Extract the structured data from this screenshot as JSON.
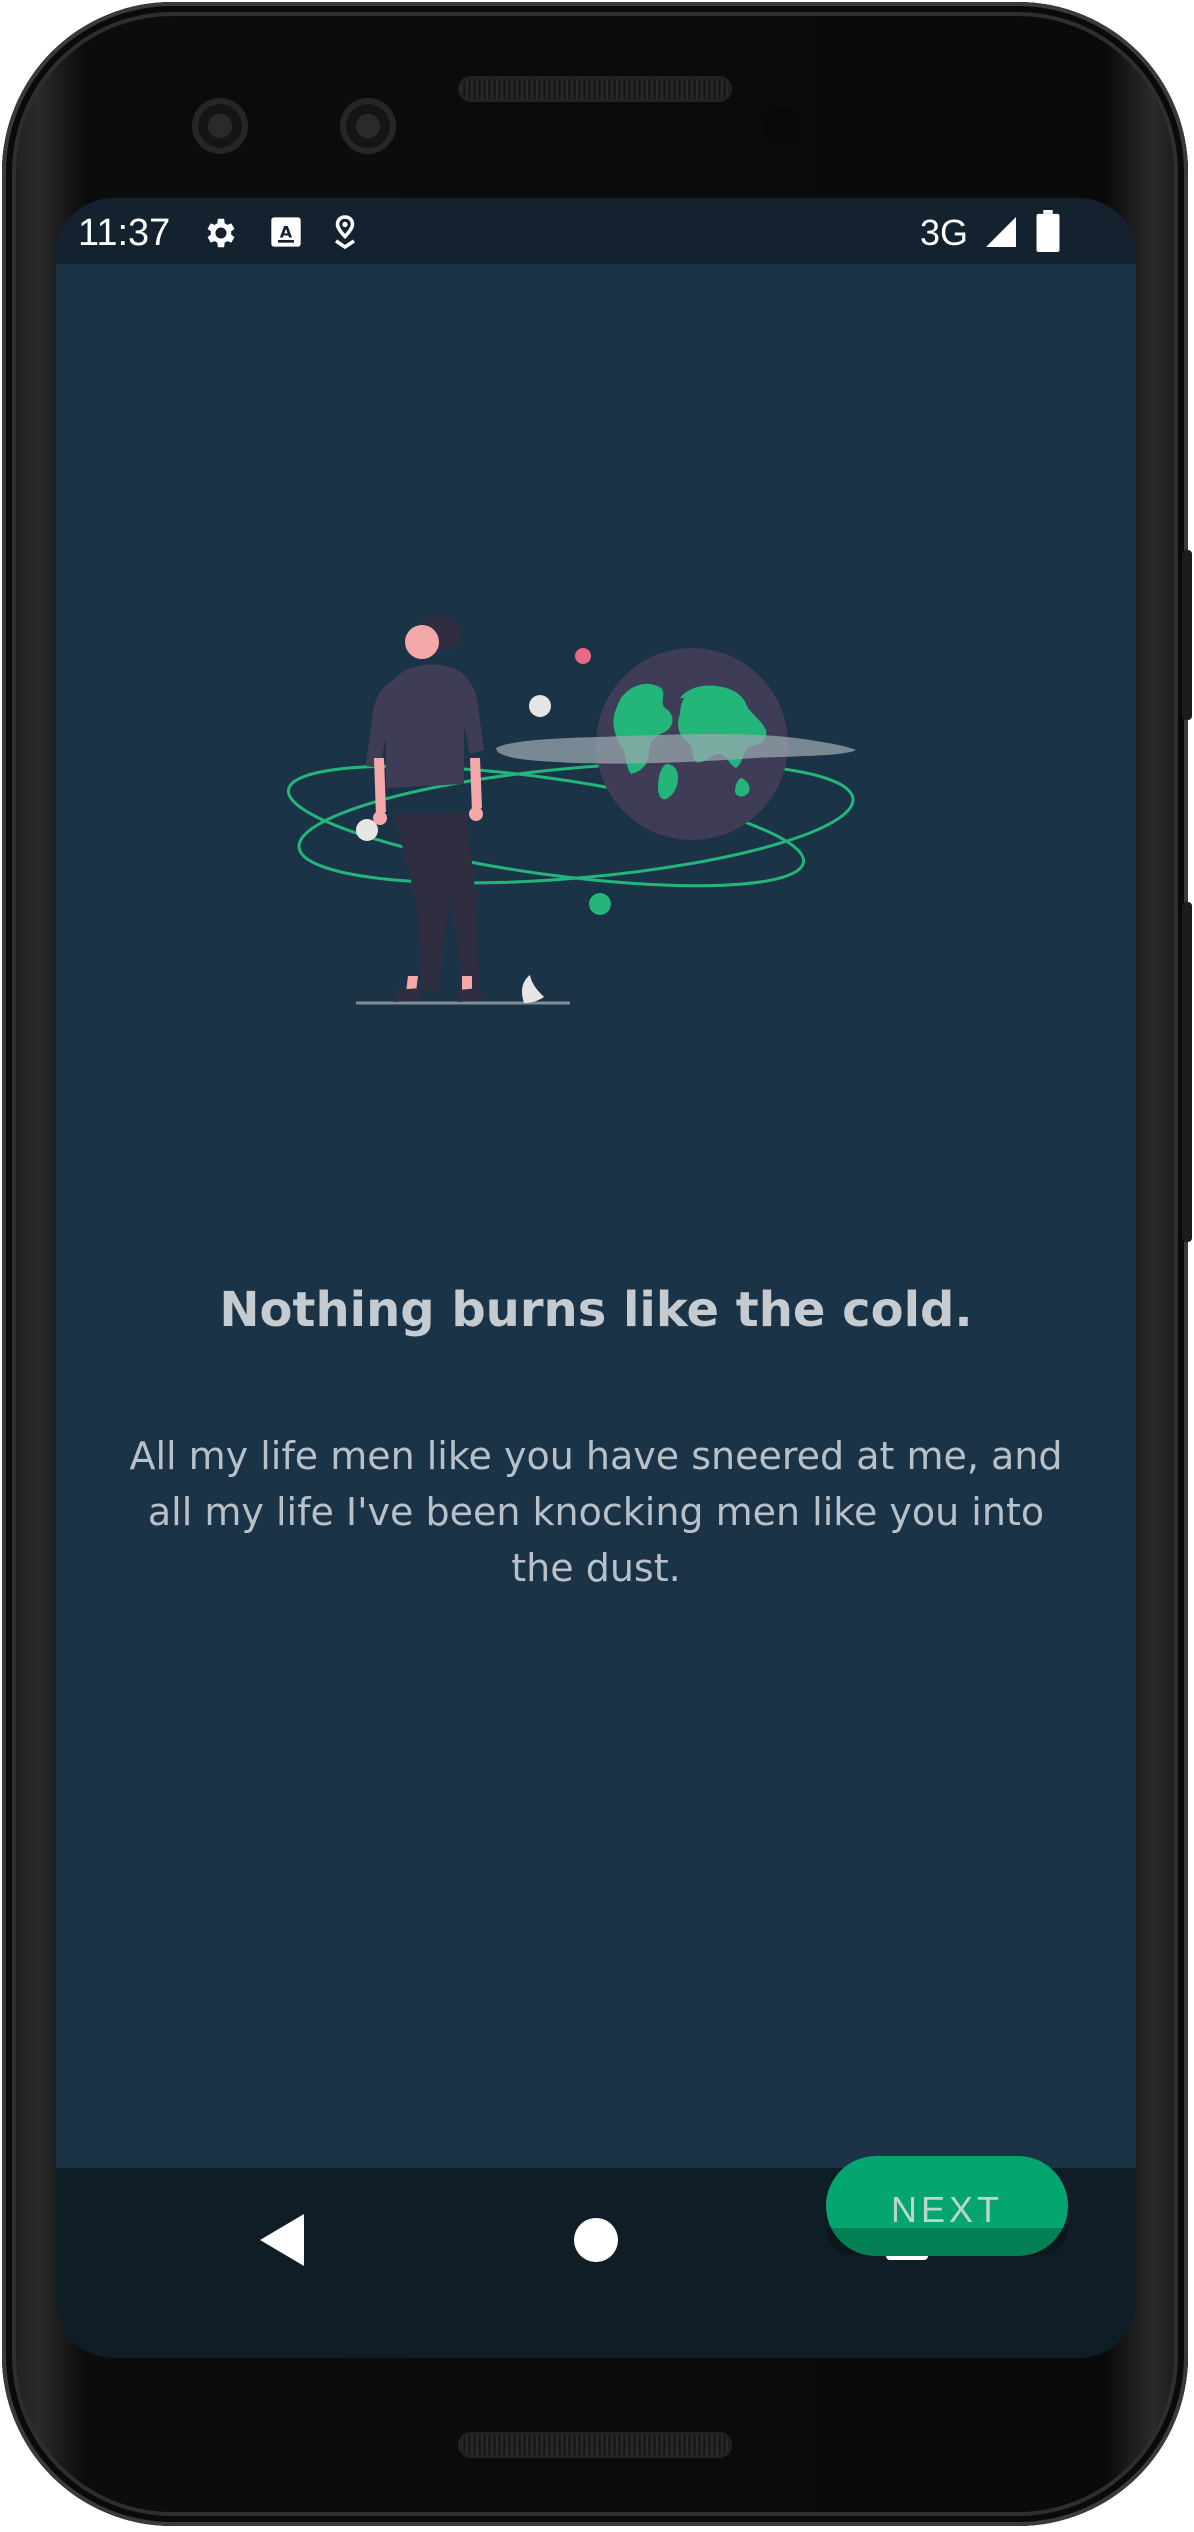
{
  "status_bar": {
    "time": "11:37",
    "network": "3G",
    "icons": [
      "settings-gear-icon",
      "keyboard-a-icon",
      "location-pin-icon",
      "signal-icon",
      "battery-icon"
    ]
  },
  "onboarding": {
    "headline": "Nothing burns like the cold.",
    "body": "All my life men like you have sneered at me, and all my life I've been knocking men like you into the dust.",
    "next_label": "NEXT",
    "illustration_icon": "person-with-globe-illustration"
  },
  "nav_bar": {
    "icons": [
      "back-triangle-icon",
      "home-circle-icon",
      "recents-square-icon"
    ]
  },
  "colors": {
    "background": "#1b3347",
    "status_bar": "#13222e",
    "nav_bar": "#0f1d26",
    "accent": "#04a56f",
    "headline": "#c4cbd1",
    "body": "#b9c1c8"
  }
}
